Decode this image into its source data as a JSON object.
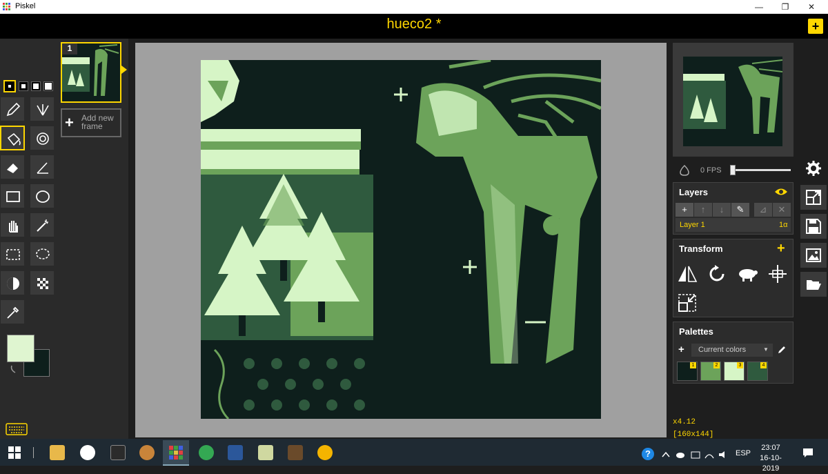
{
  "window": {
    "app_name": "Piskel",
    "minimize": "—",
    "maximize": "❐",
    "close": "✕"
  },
  "header": {
    "document_title": "hueco2 *",
    "add_label": "+"
  },
  "frames": {
    "frame_number": "1",
    "add_frame_label": "Add new frame",
    "add_symbol": "+"
  },
  "preview": {
    "fps_label": "0 FPS"
  },
  "layers": {
    "title": "Layers",
    "buttons": [
      "+",
      "↑",
      "↓",
      "✎",
      "⊿",
      "✕"
    ],
    "items": [
      {
        "name": "Layer 1",
        "opacity": "1α"
      }
    ]
  },
  "transform": {
    "title": "Transform",
    "add": "+"
  },
  "palettes": {
    "title": "Palettes",
    "add": "+",
    "selected": "Current colors",
    "dropdown_arrow": "▼",
    "colors": [
      {
        "index": "1",
        "hex": "#0e1f1c"
      },
      {
        "index": "2",
        "hex": "#6ca35a"
      },
      {
        "index": "3",
        "hex": "#d6f5c6"
      },
      {
        "index": "4",
        "hex": "#2f5a3e"
      }
    ]
  },
  "status": {
    "zoom": "x4.12",
    "size": "[160x144]"
  },
  "colors": {
    "primary": "#dff5d0",
    "secondary": "#0e1f1c",
    "accent": "#ffd700"
  },
  "taskbar": {
    "language": "ESP",
    "time": "23:07",
    "date": "16-10-2019"
  }
}
